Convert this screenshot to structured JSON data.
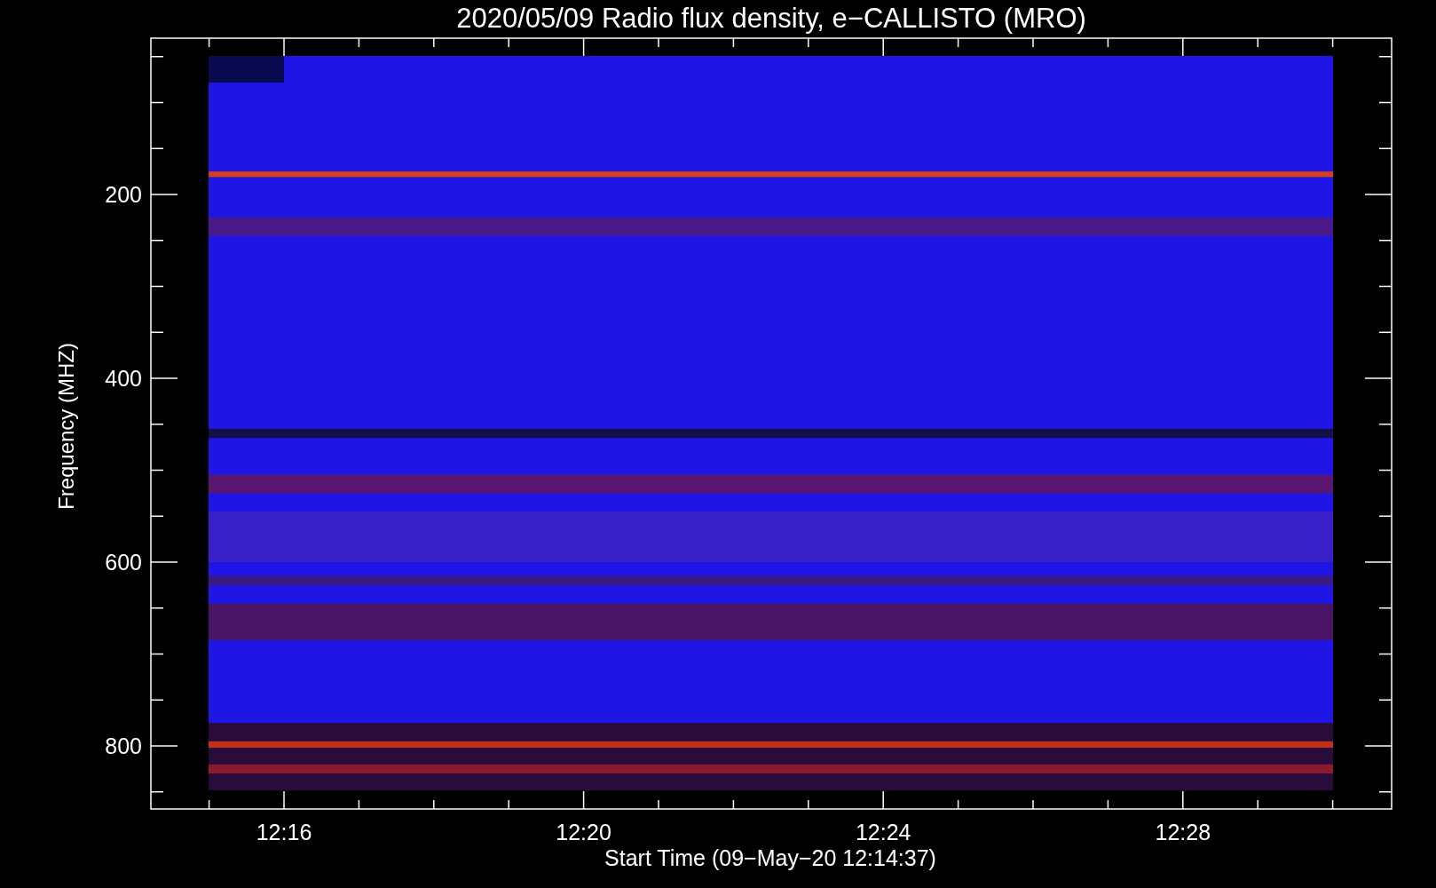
{
  "title": "2020/05/09  Radio flux density, e−CALLISTO (MRO)",
  "y_axis": {
    "label": "Frequency (MHZ)",
    "ticks": [
      "200",
      "400",
      "600",
      "800"
    ]
  },
  "x_axis": {
    "label": "Start Time (09−May−20 12:14:37)",
    "ticks": [
      "12:16",
      "12:20",
      "12:24",
      "12:28"
    ]
  }
}
